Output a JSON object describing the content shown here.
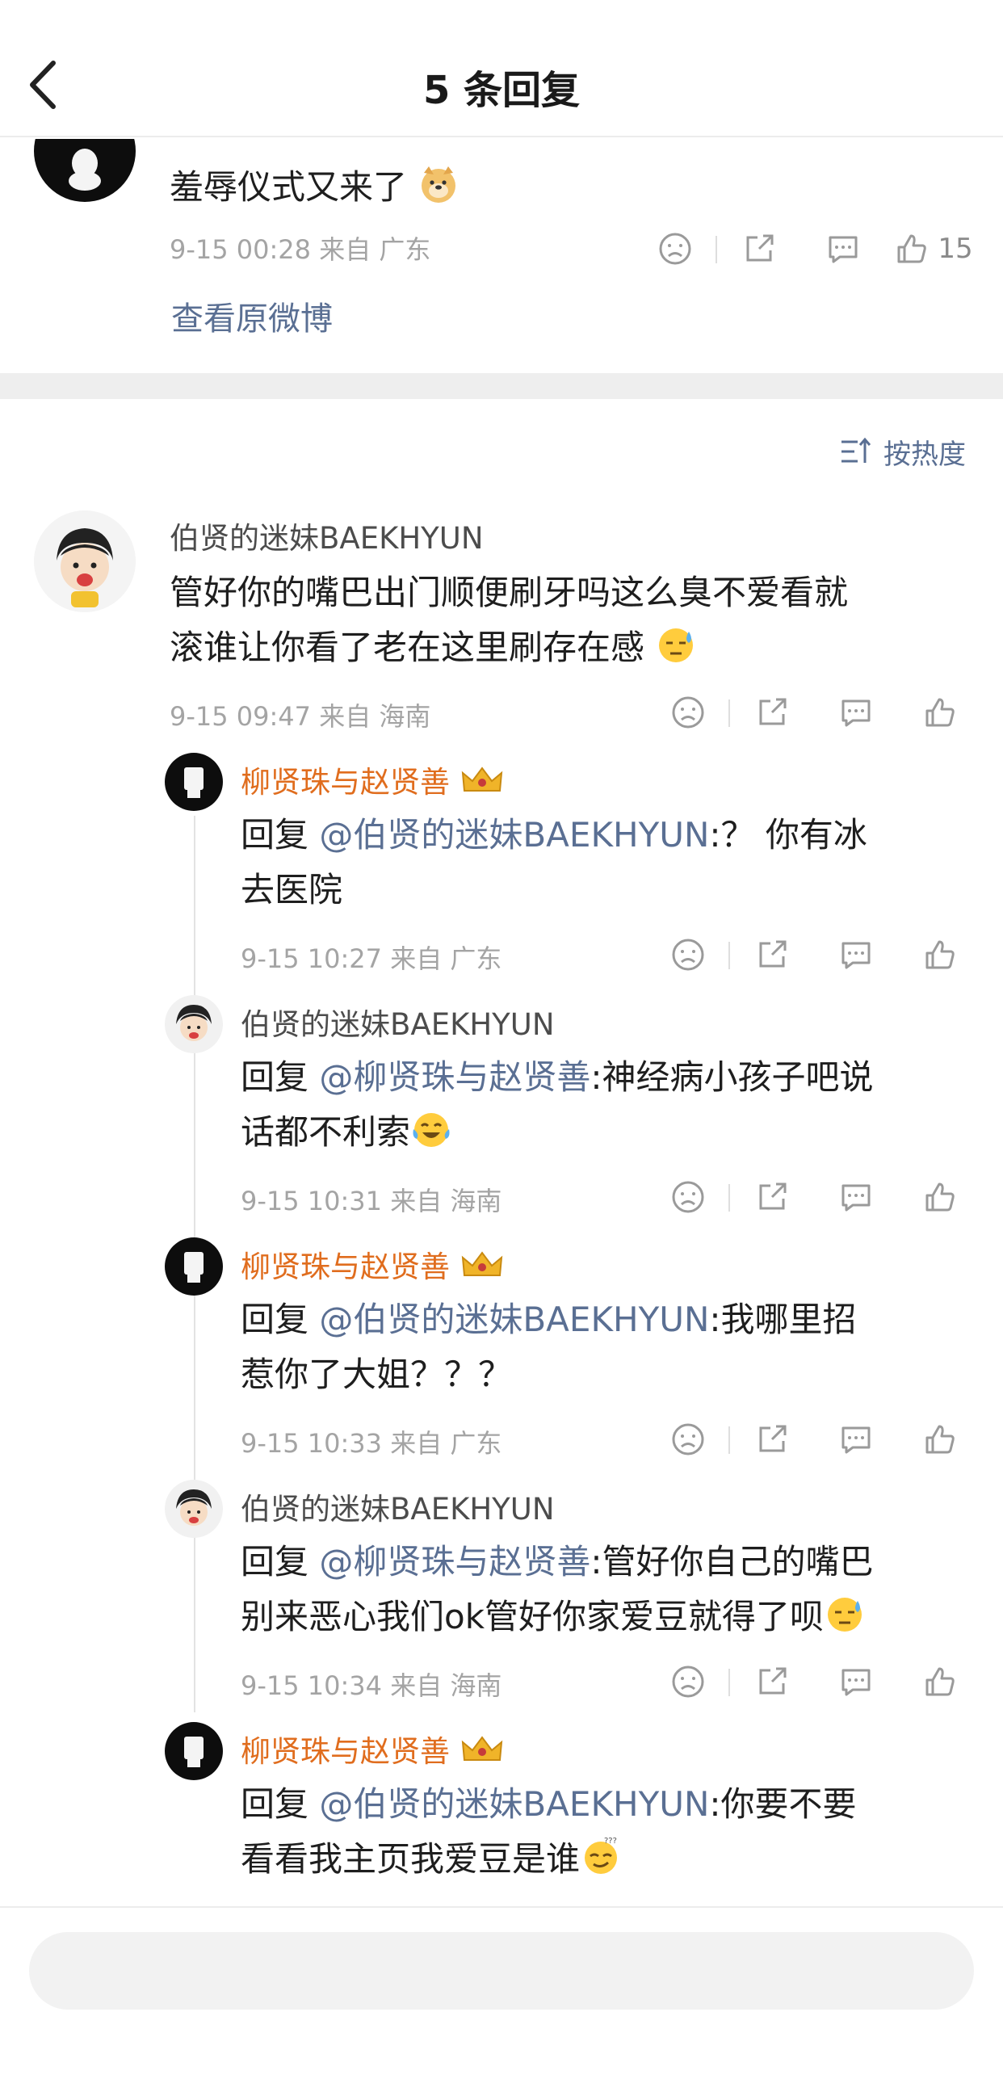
{
  "nav": {
    "title": "5 条回复"
  },
  "root": {
    "text": "羞辱仪式又来了",
    "meta": "9-15 00:28  来自 广东",
    "likes": "15",
    "view_original": "查看原微博"
  },
  "sort_label": "按热度",
  "main": {
    "username": "伯贤的迷妹BAEKHYUN",
    "line1": "管好你的嘴巴出门顺便刷牙吗这么臭不爱看就",
    "line2": "滚谁让你看了老在这里刷存在感",
    "meta": "9-15 09:47  来自 海南"
  },
  "replies": [
    {
      "username": "柳贤珠与赵贤善",
      "prefix": "回复 ",
      "mention": "@伯贤的迷妹BAEKHYUN",
      "line1": ":？ 你有冰",
      "line2": "去医院",
      "meta": "9-15 10:27  来自 广东"
    },
    {
      "username": "伯贤的迷妹BAEKHYUN",
      "prefix": "回复 ",
      "mention": "@柳贤珠与赵贤善",
      "line1": ":神经病小孩子吧说",
      "line2": "话都不利索",
      "meta": "9-15 10:31  来自 海南"
    },
    {
      "username": "柳贤珠与赵贤善",
      "prefix": "回复 ",
      "mention": "@伯贤的迷妹BAEKHYUN",
      "line1": ":我哪里招",
      "line2": "惹你了大姐？？？",
      "meta": "9-15 10:33  来自 广东"
    },
    {
      "username": "伯贤的迷妹BAEKHYUN",
      "prefix": "回复 ",
      "mention": "@柳贤珠与赵贤善",
      "line1": ":管好你自己的嘴巴",
      "line2": "别来恶心我们ok管好你家爱豆就得了呗",
      "meta": "9-15 10:34  来自 海南"
    },
    {
      "username": "柳贤珠与赵贤善",
      "prefix": "回复 ",
      "mention": "@伯贤的迷妹BAEKHYUN",
      "line1": ":你要不要",
      "line2": "看看我主页我爱豆是谁",
      "meta": ""
    }
  ],
  "colors": {
    "accent_link": "#5a6f93",
    "username_orange": "#e06d1e",
    "meta_gray": "#a4a4a4"
  },
  "icons": [
    "back-arrow-icon",
    "dislike-icon",
    "share-icon",
    "comment-icon",
    "like-icon",
    "sort-icon",
    "crown-badge-icon"
  ]
}
